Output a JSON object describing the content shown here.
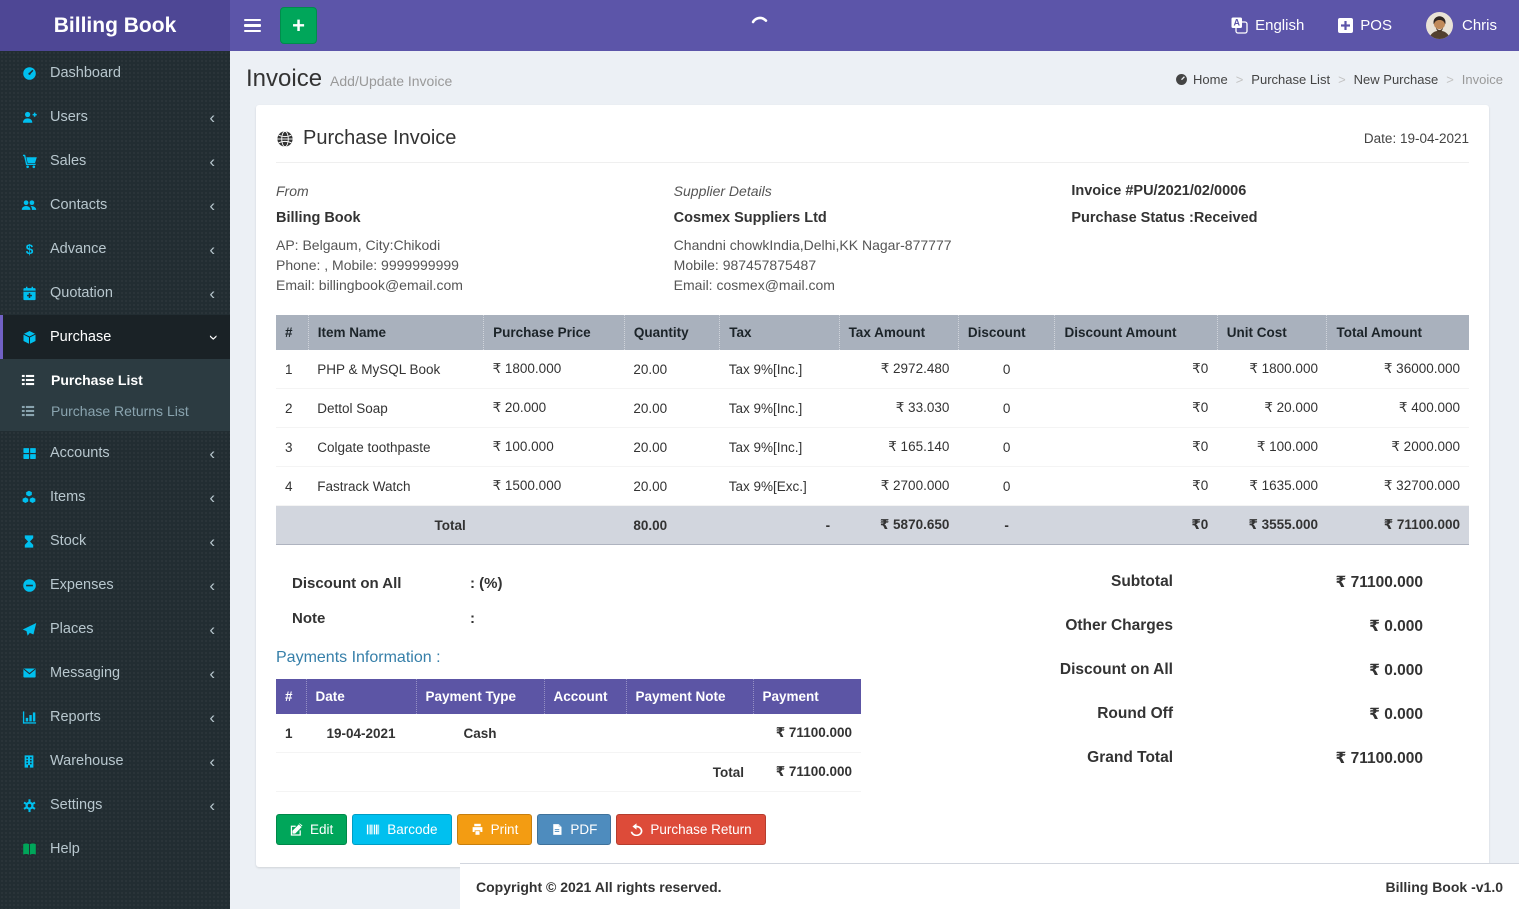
{
  "app": {
    "brand": "Billing Book",
    "copyright": "Copyright © 2021 All rights reserved.",
    "version_label": "Billing Book -v1.0"
  },
  "navbar": {
    "language_label": "English",
    "pos_label": "POS",
    "user_name": "Chris",
    "icons": [
      "hamburger-icon",
      "plus-button",
      "loading-spinner",
      "language-icon",
      "plus-square-icon",
      "avatar"
    ]
  },
  "sidebar": {
    "items": [
      {
        "label": "Dashboard",
        "icon": "dashboard-icon",
        "arrow": false
      },
      {
        "label": "Users",
        "icon": "user-plus-icon",
        "arrow": true
      },
      {
        "label": "Sales",
        "icon": "cart-icon",
        "arrow": true
      },
      {
        "label": "Contacts",
        "icon": "users-icon",
        "arrow": true
      },
      {
        "label": "Advance",
        "icon": "dollar-icon",
        "arrow": true
      },
      {
        "label": "Quotation",
        "icon": "calendar-plus-icon",
        "arrow": true
      },
      {
        "label": "Purchase",
        "icon": "cube-icon",
        "arrow": "down",
        "active": true,
        "expanded": true
      },
      {
        "label": "Accounts",
        "icon": "grid-icon",
        "arrow": true
      },
      {
        "label": "Items",
        "icon": "cubes-icon",
        "arrow": true
      },
      {
        "label": "Stock",
        "icon": "hourglass-icon",
        "arrow": true
      },
      {
        "label": "Expenses",
        "icon": "minus-circle-icon",
        "arrow": true
      },
      {
        "label": "Places",
        "icon": "paper-plane-icon",
        "arrow": true
      },
      {
        "label": "Messaging",
        "icon": "envelope-icon",
        "arrow": true
      },
      {
        "label": "Reports",
        "icon": "bar-chart-icon",
        "arrow": true
      },
      {
        "label": "Warehouse",
        "icon": "building-icon",
        "arrow": true
      },
      {
        "label": "Settings",
        "icon": "gears-icon",
        "arrow": true
      },
      {
        "label": "Help",
        "icon": "book-icon",
        "arrow": false
      }
    ],
    "purchase_submenu": [
      {
        "label": "Purchase List",
        "icon": "list-icon",
        "active": true
      },
      {
        "label": "Purchase Returns List",
        "icon": "list-icon",
        "active": false
      }
    ]
  },
  "page": {
    "title": "Invoice",
    "subtitle": "Add/Update Invoice",
    "breadcrumb": [
      "Home",
      "Purchase List",
      "New Purchase",
      "Invoice"
    ]
  },
  "invoice": {
    "section_title": "Purchase Invoice",
    "date_label": "Date: 19-04-2021",
    "from": {
      "heading": "From",
      "name": "Billing Book",
      "line1": "AP: Belgaum, City:Chikodi",
      "line2": "Phone: , Mobile: 9999999999",
      "line3": "Email: billingbook@email.com"
    },
    "supplier": {
      "heading": "Supplier Details",
      "name": "Cosmex Suppliers Ltd",
      "line1": "Chandni chowkIndia,Delhi,KK Nagar-877777",
      "line2": "Mobile: 987457875487",
      "line3": "Email: cosmex@mail.com"
    },
    "meta": {
      "invoice_no": "Invoice #PU/2021/02/0006",
      "status": "Purchase Status :Received"
    }
  },
  "items_table": {
    "headers": [
      "#",
      "Item Name",
      "Purchase Price",
      "Quantity",
      "Tax",
      "Tax Amount",
      "Discount",
      "Discount Amount",
      "Unit Cost",
      "Total Amount"
    ],
    "rows": [
      {
        "n": "1",
        "name": "PHP & MySQL Book",
        "price": "₹ 1800.000",
        "qty": "20.00",
        "tax": "Tax 9%[Inc.]",
        "tax_amount": "₹ 2972.480",
        "discount": "0",
        "discount_amount": "₹0",
        "unit_cost": "₹ 1800.000",
        "total": "₹ 36000.000"
      },
      {
        "n": "2",
        "name": "Dettol Soap",
        "price": "₹ 20.000",
        "qty": "20.00",
        "tax": "Tax 9%[Inc.]",
        "tax_amount": "₹ 33.030",
        "discount": "0",
        "discount_amount": "₹0",
        "unit_cost": "₹ 20.000",
        "total": "₹ 400.000"
      },
      {
        "n": "3",
        "name": "Colgate toothpaste",
        "price": "₹ 100.000",
        "qty": "20.00",
        "tax": "Tax 9%[Inc.]",
        "tax_amount": "₹ 165.140",
        "discount": "0",
        "discount_amount": "₹0",
        "unit_cost": "₹ 100.000",
        "total": "₹ 2000.000"
      },
      {
        "n": "4",
        "name": "Fastrack Watch",
        "price": "₹ 1500.000",
        "qty": "20.00",
        "tax": "Tax 9%[Exc.]",
        "tax_amount": "₹ 2700.000",
        "discount": "0",
        "discount_amount": "₹0",
        "unit_cost": "₹ 1635.000",
        "total": "₹ 32700.000"
      }
    ],
    "total": {
      "label": "Total",
      "qty": "80.00",
      "tax": "-",
      "tax_amount": "₹ 5870.650",
      "discount": "-",
      "discount_amount": "₹0",
      "unit_cost": "₹ 3555.000",
      "total": "₹ 71100.000"
    }
  },
  "discount_note": {
    "discount_label": "Discount on All",
    "discount_value": ": (%)",
    "note_label": "Note",
    "note_value": ":"
  },
  "payments": {
    "title": "Payments Information :",
    "headers": [
      "#",
      "Date",
      "Payment Type",
      "Account",
      "Payment Note",
      "Payment"
    ],
    "rows": [
      {
        "n": "1",
        "date": "19-04-2021",
        "type": "Cash",
        "account": "",
        "note": "",
        "amount": "₹ 71100.000"
      }
    ],
    "total_label": "Total",
    "total_amount": "₹ 71100.000"
  },
  "summary": {
    "rows": [
      {
        "label": "Subtotal",
        "value": "₹ 71100.000"
      },
      {
        "label": "Other Charges",
        "value": "₹ 0.000"
      },
      {
        "label": "Discount on All",
        "value": "₹ 0.000"
      },
      {
        "label": "Round Off",
        "value": "₹ 0.000"
      },
      {
        "label": "Grand Total",
        "value": "₹ 71100.000"
      }
    ]
  },
  "actions": {
    "edit": "Edit",
    "barcode": "Barcode",
    "print": "Print",
    "pdf": "PDF",
    "purchase_return": "Purchase Return"
  },
  "colors": {
    "navbar": "#5c55a9",
    "brand_bg": "#4e4795",
    "sidebar": "#222d32",
    "icon_cyan": "#00c0ef",
    "green": "#00a65a",
    "cyan": "#00c0ef",
    "orange": "#f39c12",
    "steel_blue": "#4e8cbe",
    "red": "#dd4b39",
    "table_header": "#a9b1bd",
    "total_row": "#d2d6de",
    "payments_header": "#5c55a5",
    "content_bg": "#ecf0f5"
  }
}
